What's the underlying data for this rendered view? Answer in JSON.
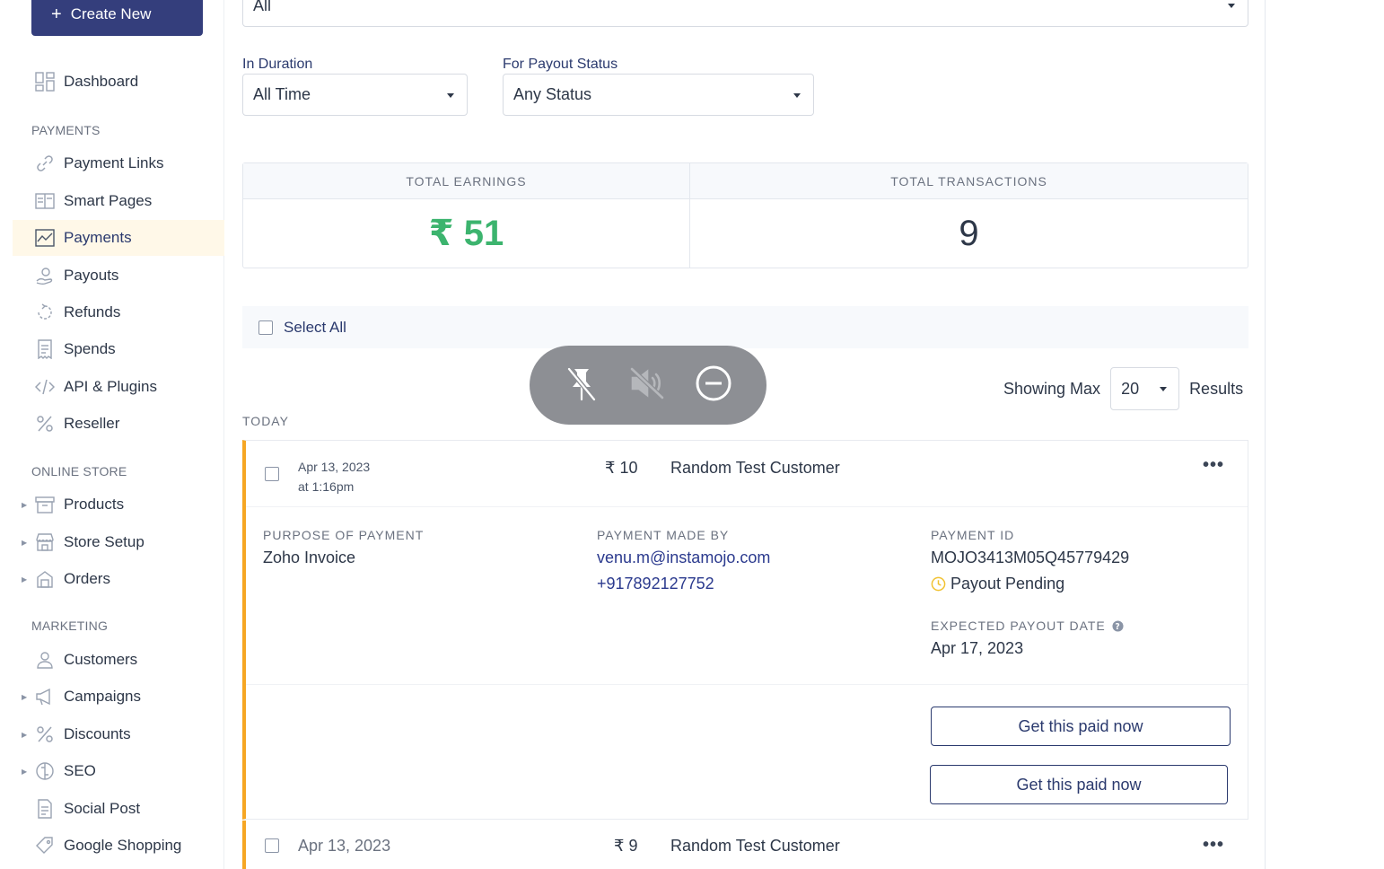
{
  "sidebar": {
    "create_label": "Create New",
    "dashboard": "Dashboard",
    "payments_section": "PAYMENTS",
    "payment_items": [
      "Payment Links",
      "Smart Pages",
      "Payments",
      "Payouts",
      "Refunds",
      "Spends",
      "API & Plugins",
      "Reseller"
    ],
    "online_store_section": "ONLINE STORE",
    "store_items": [
      "Products",
      "Store Setup",
      "Orders"
    ],
    "marketing_section": "MARKETING",
    "marketing_items": [
      "Customers",
      "Campaigns",
      "Discounts",
      "SEO",
      "Social Post",
      "Google Shopping"
    ]
  },
  "filters": {
    "top_select_value": "All",
    "duration_label": "In Duration",
    "duration_value": "All Time",
    "payout_status_label": "For Payout Status",
    "payout_status_value": "Any Status"
  },
  "stats": {
    "earnings_label": "TOTAL EARNINGS",
    "earnings_value": "₹ 51",
    "transactions_label": "TOTAL TRANSACTIONS",
    "transactions_value": "9"
  },
  "list": {
    "select_all": "Select All",
    "showing_label": "Showing Max",
    "max_value": "20",
    "results_label": "Results",
    "group_label": "TODAY"
  },
  "payment1": {
    "date": "Apr 13, 2023",
    "time": "at 1:16pm",
    "amount": "₹ 10",
    "customer": "Random Test Customer",
    "purpose_label": "PURPOSE OF PAYMENT",
    "purpose_value": "Zoho Invoice",
    "made_by_label": "PAYMENT MADE BY",
    "email": "venu.m@instamojo.com",
    "phone": "+917892127752",
    "id_label": "PAYMENT ID",
    "id_value": "MOJO3413M05Q45779429",
    "status": "Payout Pending",
    "expected_label": "EXPECTED PAYOUT DATE",
    "expected_value": "Apr 17, 2023",
    "action_1": "Get this paid now",
    "action_2": "Get this paid now"
  },
  "payment2": {
    "date": "Apr 13, 2023",
    "amount": "₹ 9",
    "customer": "Random Test Customer"
  }
}
